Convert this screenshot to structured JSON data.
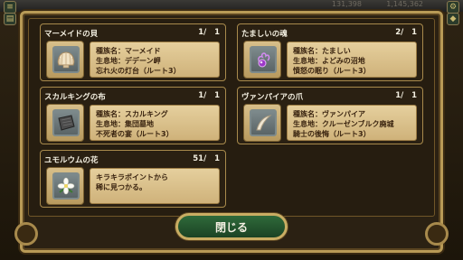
{
  "top_bar": {
    "value_1": "131,398",
    "value_2": "1,145,362"
  },
  "cards": [
    {
      "name": "マーメイドの貝",
      "count": "1/   1",
      "icon": "shell-icon",
      "lines": [
        "種族名：マーメイド",
        "生息地：デデーン岬",
        "      忘れ火の灯台（ルート3）"
      ]
    },
    {
      "name": "たましいの魂",
      "count": "2/   1",
      "icon": "purple-soul-icon",
      "lines": [
        "種族名：たましい",
        "生息地：よどみの沼地",
        "      憤怒の眠り（ルート3）"
      ]
    },
    {
      "name": "スカルキングの布",
      "count": "1/   1",
      "icon": "dark-cloth-icon",
      "lines": [
        "種族名：スカルキング",
        "生息地：集団墓地",
        "      不死者の宴（ルート3）"
      ]
    },
    {
      "name": "ヴァンパイアの爪",
      "count": "1/   1",
      "icon": "claw-icon",
      "lines": [
        "種族名：ヴァンパイア",
        "生息地：クルーゼンブルク廃城",
        "      騎士の後悔（ルート3）"
      ]
    },
    {
      "name": "ユモルウムの花",
      "count": "51/   1",
      "icon": "white-flower-icon",
      "lines": [
        "キラキラポイントから",
        "稀に見つかる。",
        ""
      ]
    }
  ],
  "close_button": {
    "label": "閉じる"
  },
  "colors": {
    "frame_gold": "#b89a56",
    "plank": "#e5cf9d",
    "button_green": "#2f6a3a"
  }
}
